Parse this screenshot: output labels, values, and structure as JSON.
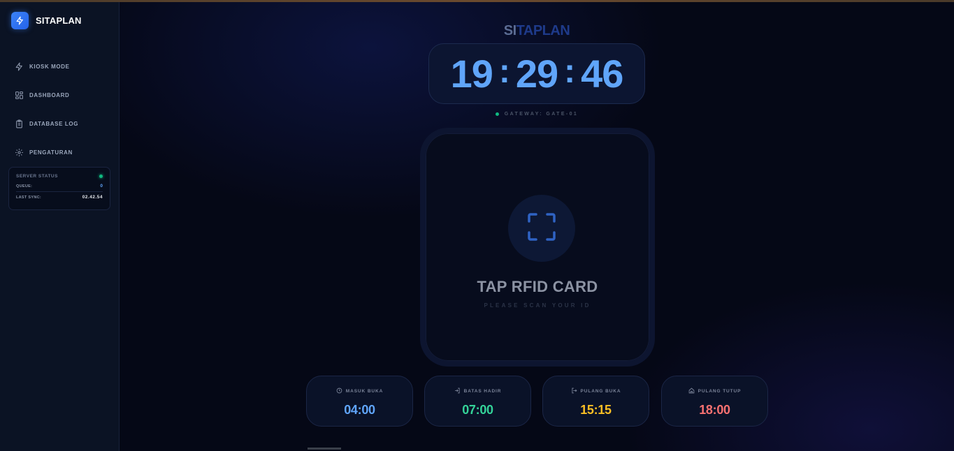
{
  "sidebar": {
    "brand": "SITAPLAN",
    "items": [
      {
        "label": "KIOSK MODE",
        "icon": "lightning-icon"
      },
      {
        "label": "DASHBOARD",
        "icon": "grid-icon"
      },
      {
        "label": "DATABASE LOG",
        "icon": "clipboard-icon"
      },
      {
        "label": "PENGATURAN",
        "icon": "gear-icon"
      }
    ],
    "server": {
      "title": "SERVER STATUS",
      "queue_label": "QUEUE:",
      "queue_value": "0",
      "sync_label": "LAST SYNC:",
      "sync_value": "02.42.54"
    }
  },
  "main": {
    "title_part1": "SI",
    "title_part2": "TAPLAN",
    "clock": {
      "hours": "19",
      "minutes": "29",
      "seconds": "46",
      "sep": ":"
    },
    "gateway": "GATEWAY: GATE-01",
    "scan": {
      "title": "TAP RFID CARD",
      "subtitle": "PLEASE SCAN YOUR ID"
    },
    "schedule": [
      {
        "label": "MASUK BUKA",
        "time": "04:00",
        "icon": "clock-icon",
        "color": "#60a5fa"
      },
      {
        "label": "BATAS HADIR",
        "time": "07:00",
        "icon": "login-icon",
        "color": "#34d399"
      },
      {
        "label": "PULANG BUKA",
        "time": "15:15",
        "icon": "logout-icon",
        "color": "#fbbf24"
      },
      {
        "label": "PULANG TUTUP",
        "time": "18:00",
        "icon": "home-icon",
        "color": "#f87171"
      }
    ]
  },
  "colors": {
    "accent": "#3b82f6",
    "status_online": "#10b981"
  }
}
